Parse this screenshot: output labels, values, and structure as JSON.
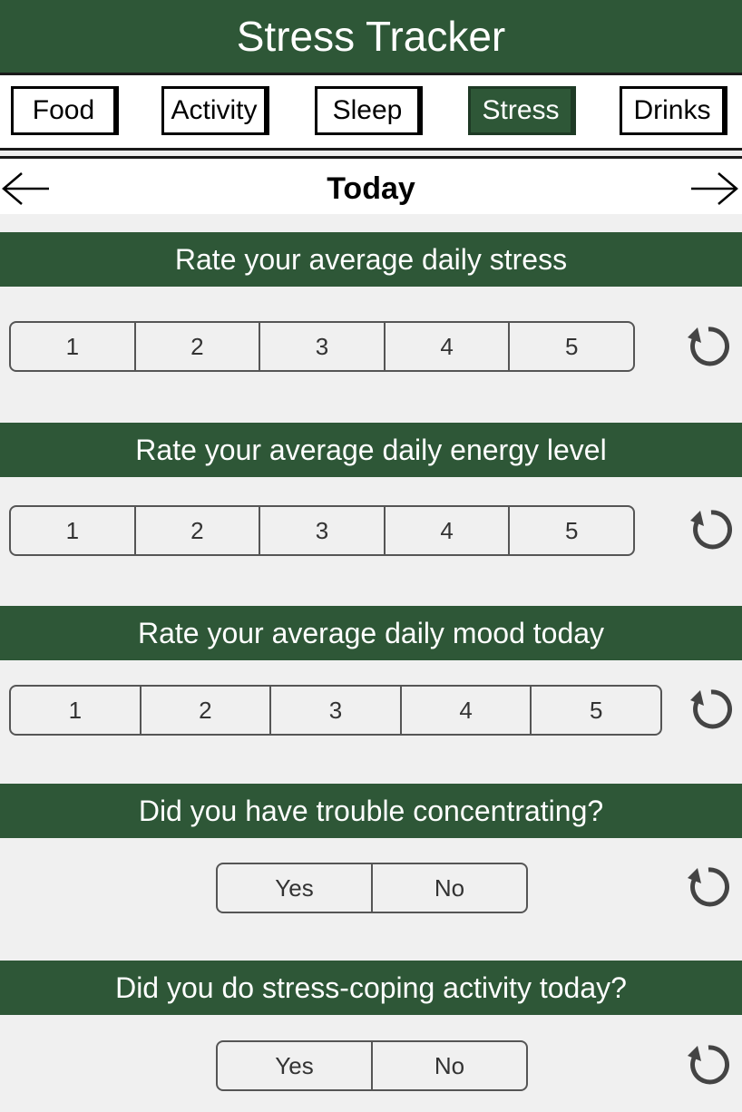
{
  "app": {
    "title": "Stress Tracker"
  },
  "tabs": [
    {
      "label": "Food",
      "active": false
    },
    {
      "label": "Activity",
      "active": false
    },
    {
      "label": "Sleep",
      "active": false
    },
    {
      "label": "Stress",
      "active": true
    },
    {
      "label": "Drinks",
      "active": false
    }
  ],
  "day_nav": {
    "label": "Today",
    "prev_icon": "arrow-left-icon",
    "next_icon": "arrow-right-icon"
  },
  "questions": [
    {
      "prompt": "Rate your average daily stress",
      "options": [
        "1",
        "2",
        "3",
        "4",
        "5"
      ],
      "reset_icon": "reset-icon"
    },
    {
      "prompt": "Rate your average daily energy level",
      "options": [
        "1",
        "2",
        "3",
        "4",
        "5"
      ],
      "reset_icon": "reset-icon"
    },
    {
      "prompt": "Rate your average daily mood today",
      "options": [
        "1",
        "2",
        "3",
        "4",
        "5"
      ],
      "reset_icon": "reset-icon"
    },
    {
      "prompt": "Did you have trouble concentrating?",
      "options": [
        "Yes",
        "No"
      ],
      "reset_icon": "reset-icon"
    },
    {
      "prompt": "Did you do stress-coping activity today?",
      "options": [
        "Yes",
        "No"
      ],
      "reset_icon": "reset-icon"
    }
  ],
  "colors": {
    "accent": "#2e5737",
    "background": "#f0f0f0",
    "tab_border": "#000000"
  }
}
